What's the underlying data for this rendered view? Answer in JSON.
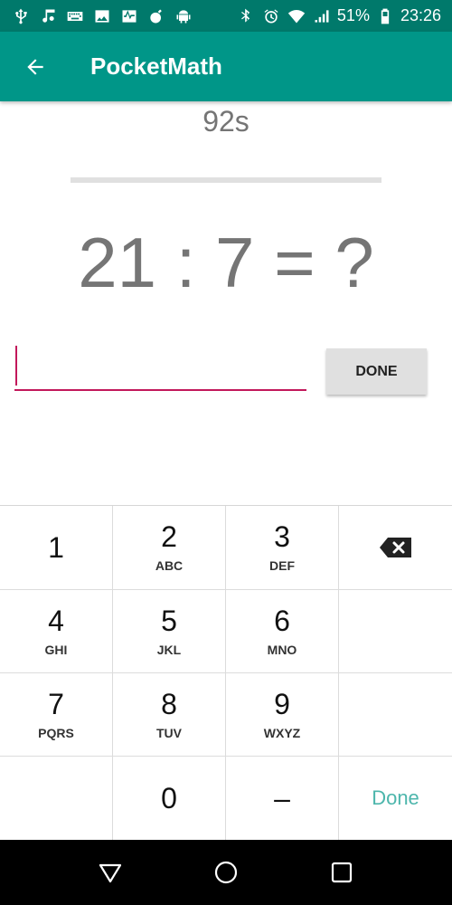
{
  "status_bar": {
    "battery_percent": "51%",
    "time": "23:26",
    "left_icons": [
      "usb-icon",
      "music-icon",
      "keyboard-icon",
      "image-icon",
      "activity-icon",
      "bomb-icon",
      "android-icon"
    ],
    "right_icons": [
      "bluetooth-icon",
      "alarm-icon",
      "wifi-icon",
      "signal-icon",
      "battery-icon"
    ]
  },
  "app_bar": {
    "title": "PocketMath",
    "background_color": "#009688",
    "status_color": "#00796b"
  },
  "quiz": {
    "timer": "92s",
    "progress": 0.0,
    "question": "21 : 7 = ?",
    "answer_value": "",
    "done_label": "DONE",
    "accent_color": "#c2185b"
  },
  "keypad": {
    "keys": [
      {
        "digit": "1",
        "letters": ""
      },
      {
        "digit": "2",
        "letters": "ABC"
      },
      {
        "digit": "3",
        "letters": "DEF"
      },
      {
        "digit": "",
        "letters": "",
        "icon": "backspace-icon"
      },
      {
        "digit": "4",
        "letters": "GHI"
      },
      {
        "digit": "5",
        "letters": "JKL"
      },
      {
        "digit": "6",
        "letters": "MNO"
      },
      {
        "digit": "",
        "letters": ""
      },
      {
        "digit": "7",
        "letters": "PQRS"
      },
      {
        "digit": "8",
        "letters": "TUV"
      },
      {
        "digit": "9",
        "letters": "WXYZ"
      },
      {
        "digit": "",
        "letters": ""
      },
      {
        "digit": "",
        "letters": ""
      },
      {
        "digit": "0",
        "letters": ""
      },
      {
        "digit": "–",
        "letters": ""
      },
      {
        "digit": "",
        "letters": "",
        "label": "Done"
      }
    ],
    "done_color": "#4db6ac"
  },
  "nav_bar": {
    "buttons": [
      "back-triangle-icon",
      "home-circle-icon",
      "recents-square-icon"
    ]
  }
}
